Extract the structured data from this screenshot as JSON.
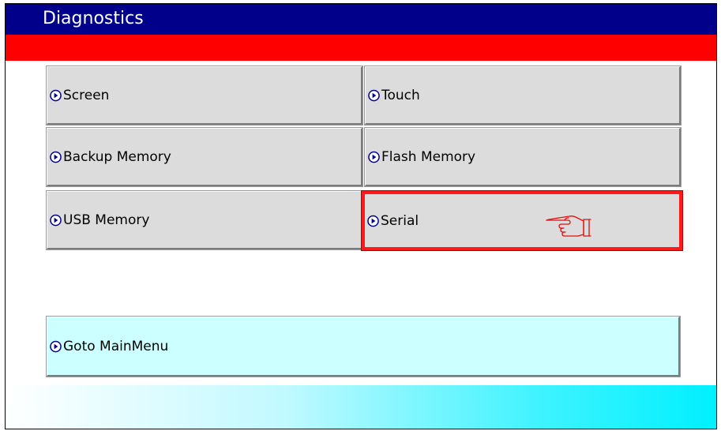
{
  "window": {
    "title": "Diagnostics"
  },
  "buttons": {
    "screen": "Screen",
    "touch": "Touch",
    "backup_memory": "Backup Memory",
    "flash_memory": "Flash Memory",
    "usb_memory": "USB Memory",
    "serial": "Serial",
    "goto_mainmenu": "Goto MainMenu"
  },
  "colors": {
    "titlebar": "#00008b",
    "accent_bar": "#ff0000",
    "button_face": "#dcdcdc",
    "goto_button_face": "#ccffff",
    "selection_border": "#ff1a1a"
  },
  "icons": {
    "button_bullet": "circle-arrow-right-icon",
    "pointer": "pointing-hand-icon"
  },
  "state": {
    "selected_button": "Serial"
  }
}
